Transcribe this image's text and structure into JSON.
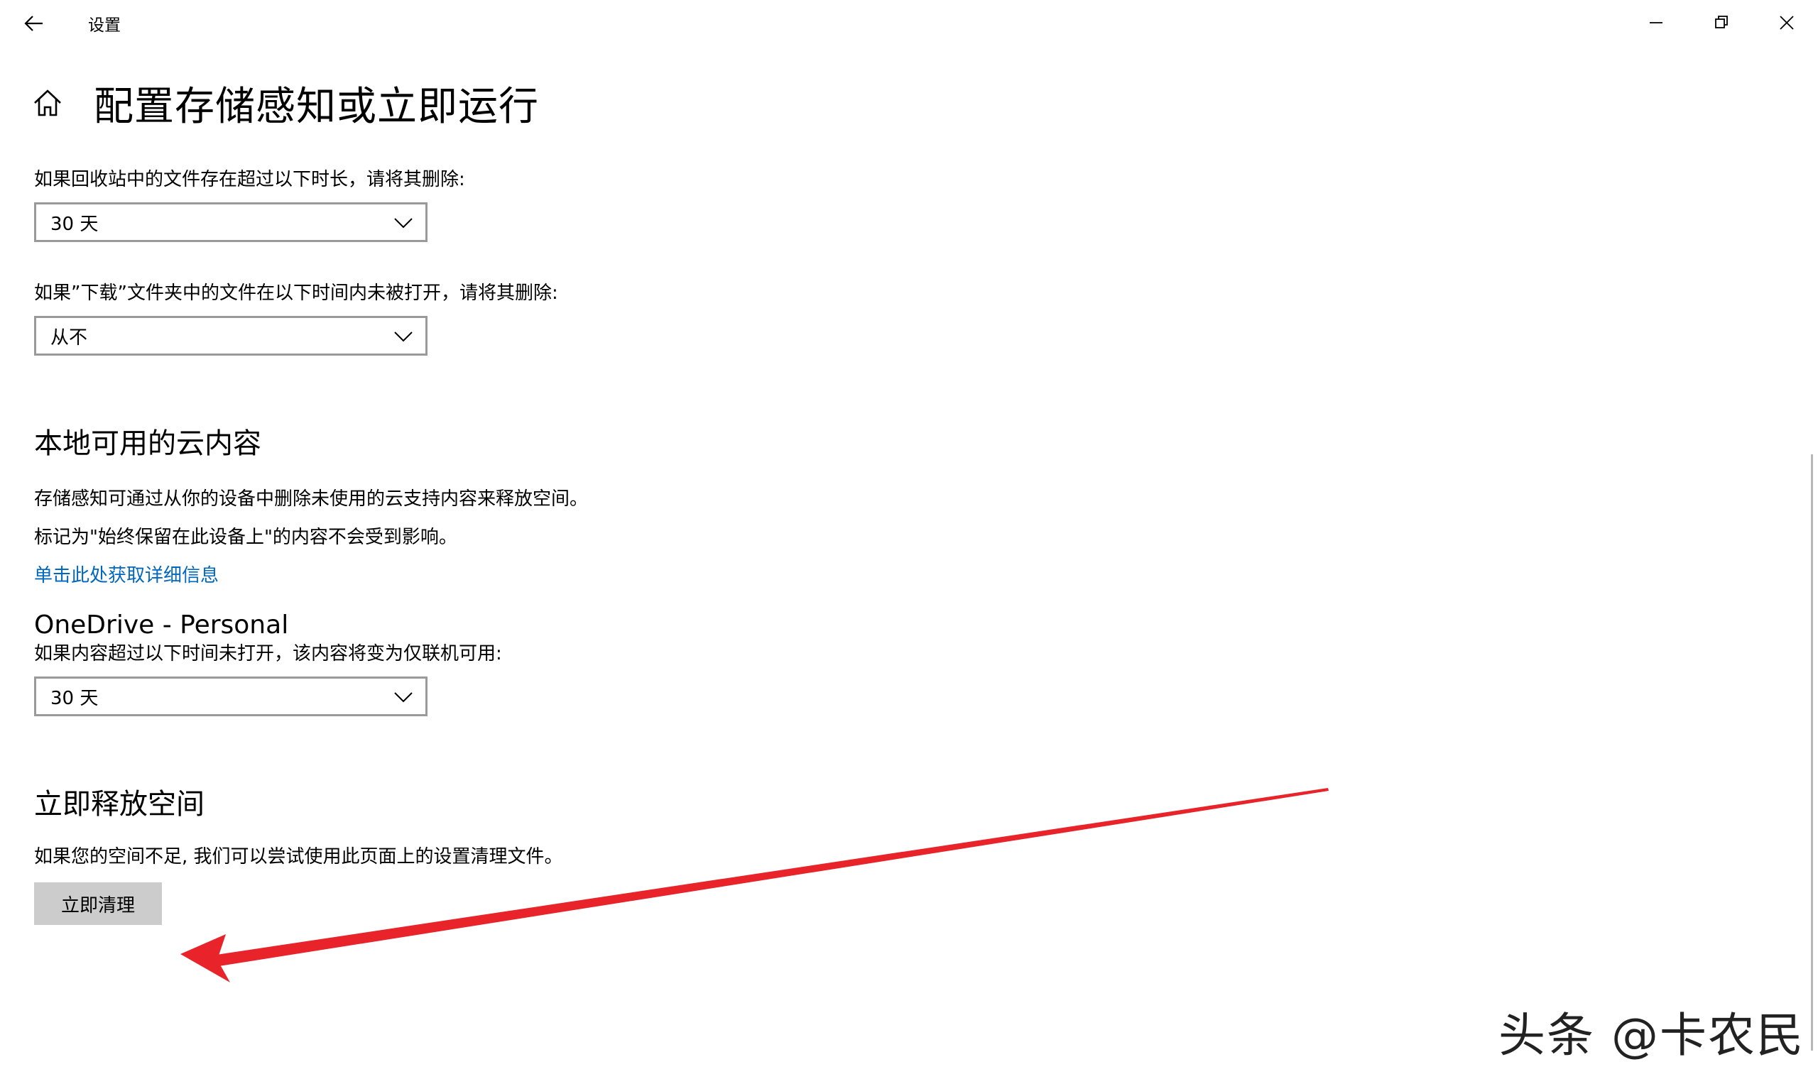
{
  "window": {
    "title": "设置",
    "back_icon": "back-arrow-icon",
    "minimize_icon": "minimize-icon",
    "maximize_icon": "restore-icon",
    "close_icon": "close-icon"
  },
  "header": {
    "home_icon": "home-icon",
    "title": "配置存储感知或立即运行"
  },
  "recycle": {
    "label": "如果回收站中的文件存在超过以下时长，请将其删除:",
    "value": "30 天"
  },
  "downloads": {
    "label": "如果”下载”文件夹中的文件在以下时间内未被打开，请将其删除:",
    "value": "从不"
  },
  "cloud": {
    "heading": "本地可用的云内容",
    "desc1": "存储感知可通过从你的设备中删除未使用的云支持内容来释放空间。",
    "desc2": "标记为\"始终保留在此设备上\"的内容不会受到影响。",
    "link": "单击此处获取详细信息",
    "account": "OneDrive - Personal",
    "label": "如果内容超过以下时间未打开，该内容将变为仅联机可用:",
    "value": "30 天"
  },
  "free_space": {
    "heading": "立即释放空间",
    "desc": "如果您的空间不足, 我们可以尝试使用此页面上的设置清理文件。",
    "button": "立即清理"
  },
  "annotation": {
    "color": "#e8232a"
  },
  "watermark": {
    "text": "头条 @卡农民"
  },
  "colors": {
    "link": "#0067c0",
    "button_bg": "#cccccc",
    "dropdown_border": "#9a9a9a"
  }
}
